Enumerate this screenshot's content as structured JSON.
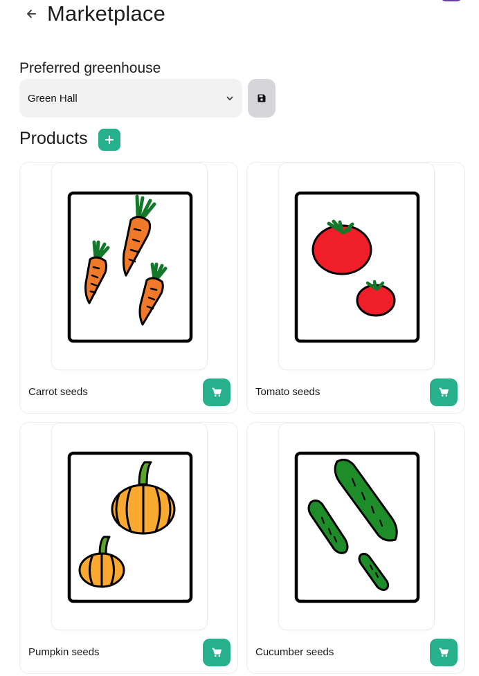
{
  "header": {
    "back_icon": "arrow-left-icon",
    "title": "Marketplace"
  },
  "greenhouse": {
    "label": "Preferred greenhouse",
    "selected": "Green Hall",
    "dropdown_icon": "chevron-down-icon",
    "save_icon": "floppy-disk-icon"
  },
  "products": {
    "title": "Products",
    "add_icon": "plus-icon",
    "items": [
      {
        "name": "Carrot seeds",
        "image": "carrot-image",
        "cart_icon": "cart-icon"
      },
      {
        "name": "Tomato seeds",
        "image": "tomato-image",
        "cart_icon": "cart-icon"
      },
      {
        "name": "Pumpkin seeds",
        "image": "pumpkin-image",
        "cart_icon": "cart-icon"
      },
      {
        "name": "Cucumber seeds",
        "image": "cucumber-image",
        "cart_icon": "cart-icon"
      }
    ]
  },
  "colors": {
    "accent": "#26b08c",
    "save_button": "#d6d6da",
    "select_bg": "#f2f2f2",
    "corner_badge": "#6b3fa0"
  }
}
